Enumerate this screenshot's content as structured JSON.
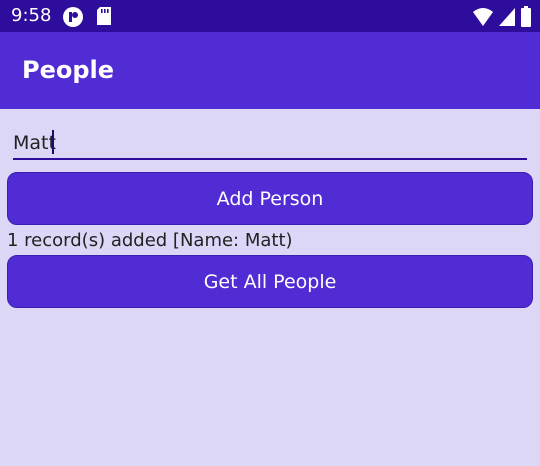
{
  "status_bar": {
    "time": "9:58",
    "left_icons": [
      "app-notification-icon",
      "sd-card-icon"
    ],
    "right_icons": [
      "wifi-icon",
      "signal-icon",
      "battery-icon"
    ]
  },
  "app_bar": {
    "title": "People"
  },
  "form": {
    "name_value": "Matt",
    "add_button_label": "Add Person",
    "status_message": "1 record(s) added [Name: Matt)",
    "get_button_label": "Get All People"
  },
  "colors": {
    "status_bar": "#2f0d9c",
    "app_bar": "#512bd4",
    "background": "#dcd6f7",
    "button": "#512bd4"
  }
}
